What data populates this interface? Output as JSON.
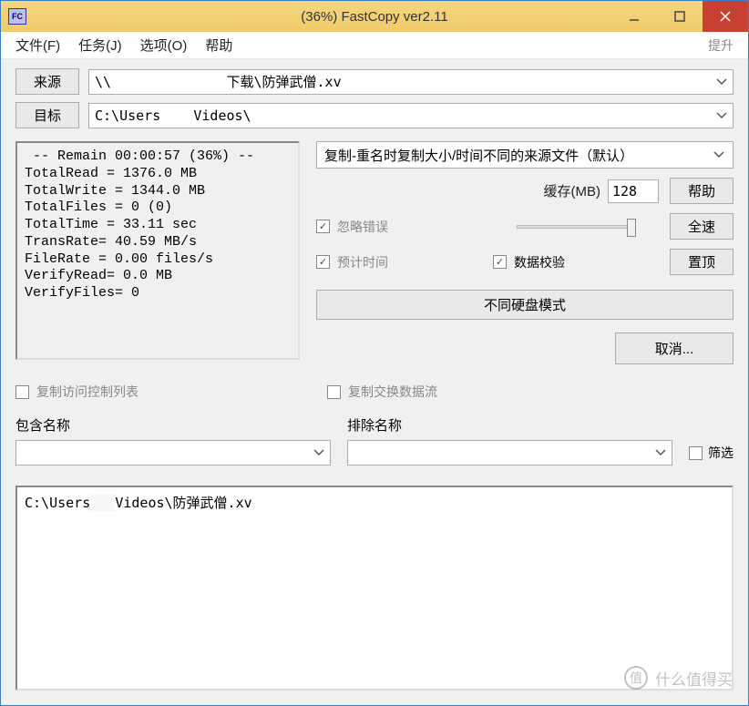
{
  "window": {
    "title": "(36%) FastCopy ver2.11",
    "app_icon_text": "FC"
  },
  "menu": {
    "file": "文件(F)",
    "task": "任务(J)",
    "options": "选项(O)",
    "help": "帮助",
    "upgrade": "提升"
  },
  "paths": {
    "source_btn": "来源",
    "dest_btn": "目标",
    "source_value": "\\\\              下载\\防弹武僧.xv",
    "dest_value": "C:\\Users    Videos\\"
  },
  "status_text": " -- Remain 00:00:57 (36%) --\nTotalRead = 1376.0 MB\nTotalWrite = 1344.0 MB\nTotalFiles = 0 (0)\nTotalTime = 33.11 sec\nTransRate= 40.59 MB/s\nFileRate = 0.00 files/s\nVerifyRead= 0.0 MB\nVerifyFiles= 0",
  "options": {
    "mode": "复制-重名时复制大小/时间不同的来源文件（默认）",
    "cache_label": "缓存(MB)",
    "cache_value": "128",
    "help_btn": "帮助",
    "ignore_errors": "忽略错误",
    "fullspeed_btn": "全速",
    "estimate_time": "预计时间",
    "data_verify": "数据校验",
    "topmost_btn": "置顶",
    "diff_disk_mode": "不同硬盘模式",
    "cancel_btn": "取消..."
  },
  "ext": {
    "acl": "复制访问控制列表",
    "altstream": "复制交换数据流"
  },
  "filter": {
    "include_label": "包含名称",
    "exclude_label": "排除名称",
    "toggle_label": "筛选"
  },
  "log": {
    "line1_a": "C:\\Users",
    "line1_b": "Videos\\防弹武僧.xv"
  },
  "watermark": {
    "icon": "值",
    "text": "什么值得买"
  }
}
